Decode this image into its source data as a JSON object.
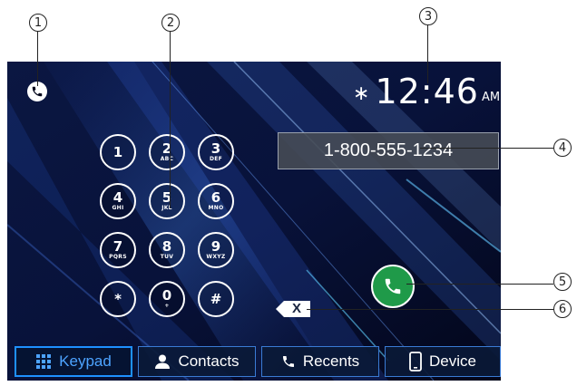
{
  "status": {
    "time": "12:46",
    "ampm": "AM",
    "bluetooth_icon": "bluetooth-icon",
    "phone_icon": "phone-icon"
  },
  "display": {
    "number": "1-800-555-1234"
  },
  "keypad": [
    {
      "digit": "1",
      "letters": ""
    },
    {
      "digit": "2",
      "letters": "ABC"
    },
    {
      "digit": "3",
      "letters": "DEF"
    },
    {
      "digit": "4",
      "letters": "GHI"
    },
    {
      "digit": "5",
      "letters": "JKL"
    },
    {
      "digit": "6",
      "letters": "MNO"
    },
    {
      "digit": "7",
      "letters": "PQRS"
    },
    {
      "digit": "8",
      "letters": "TUV"
    },
    {
      "digit": "9",
      "letters": "WXYZ"
    },
    {
      "digit": "*",
      "letters": ""
    },
    {
      "digit": "0",
      "letters": "+"
    },
    {
      "digit": "#",
      "letters": ""
    }
  ],
  "backspace": {
    "label": "X"
  },
  "tabs": [
    {
      "label": "Keypad",
      "icon": "keypad-icon",
      "active": true
    },
    {
      "label": "Contacts",
      "icon": "contacts-icon",
      "active": false
    },
    {
      "label": "Recents",
      "icon": "recents-icon",
      "active": false
    },
    {
      "label": "Device",
      "icon": "device-icon",
      "active": false
    }
  ],
  "callouts": [
    "1",
    "2",
    "3",
    "4",
    "5",
    "6"
  ],
  "colors": {
    "accent": "#1e90ff",
    "call_green": "#1f9a49",
    "background": "#05081c"
  }
}
